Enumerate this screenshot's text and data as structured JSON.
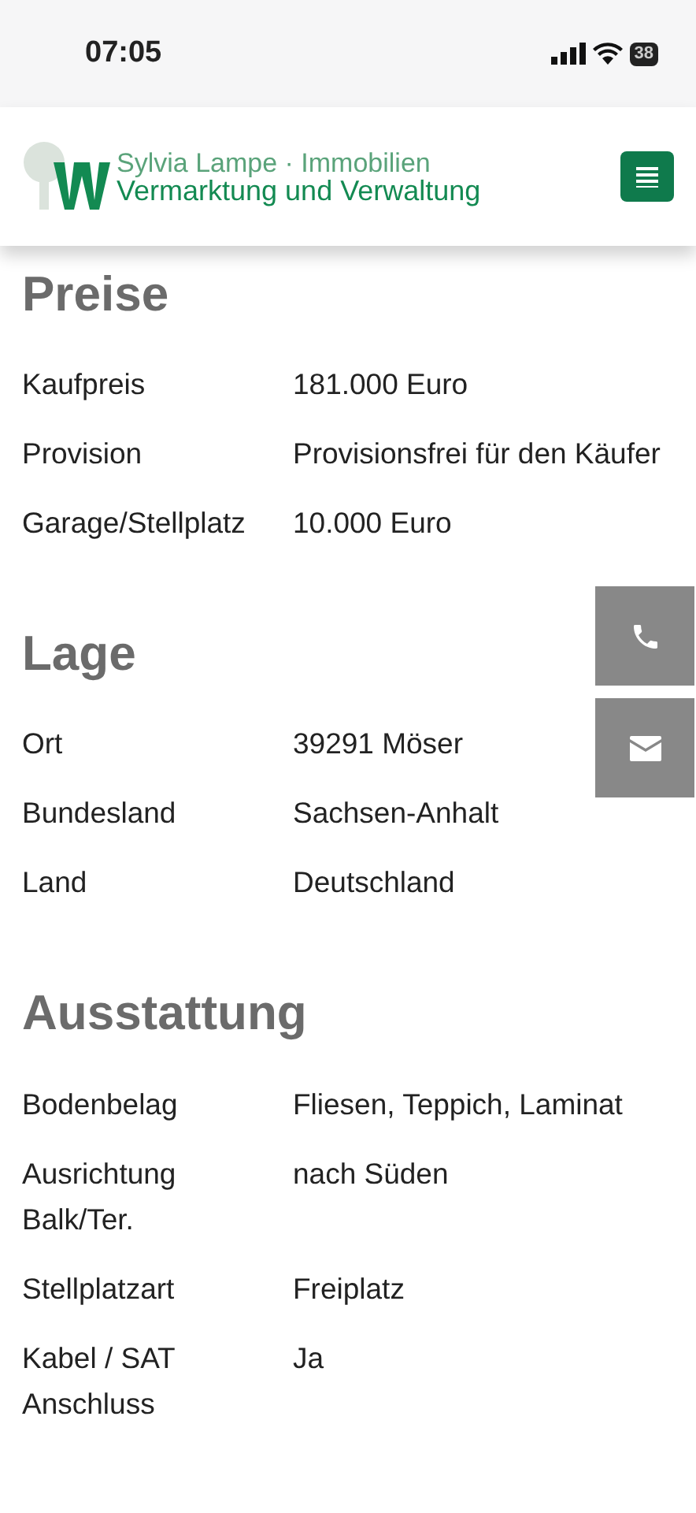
{
  "status_bar": {
    "time": "07:05",
    "battery": "38"
  },
  "header": {
    "logo_line_1": "Sylvia Lampe · Immobilien",
    "logo_line_2": "Vermarktung und Verwaltung"
  },
  "sections": [
    {
      "title": "Preise",
      "rows": [
        {
          "label": "Kaufpreis",
          "value": "181.000 Euro"
        },
        {
          "label": "Provision",
          "value": "Provisionsfrei für den Käufer"
        },
        {
          "label": "Garage/Stellplatz",
          "value": "10.000 Euro"
        }
      ]
    },
    {
      "title": "Lage",
      "rows": [
        {
          "label": "Ort",
          "value": "39291 Möser"
        },
        {
          "label": "Bundesland",
          "value": "Sachsen-Anhalt"
        },
        {
          "label": "Land",
          "value": "Deutschland"
        }
      ]
    },
    {
      "title": "Ausstattung",
      "rows": [
        {
          "label": "Bodenbelag",
          "value": "Fliesen, Teppich, Laminat"
        },
        {
          "label": "Ausrichtung Balk/Ter.",
          "value": "nach Süden"
        },
        {
          "label": "Stellplatzart",
          "value": "Freiplatz"
        },
        {
          "label": "Kabel / SAT Anschluss",
          "value": "Ja"
        }
      ]
    }
  ]
}
